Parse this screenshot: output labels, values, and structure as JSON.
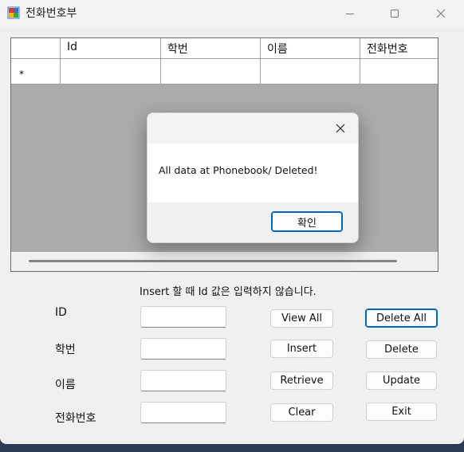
{
  "window": {
    "title": "전화번호부"
  },
  "grid": {
    "columns": [
      "Id",
      "학번",
      "이름",
      "전화번호"
    ],
    "new_row_marker": "*"
  },
  "dialog": {
    "message": "All data at Phonebook/ Deleted!",
    "ok_label": "확인"
  },
  "form": {
    "hint": "Insert 할 때 Id 값은 입력하지 않습니다.",
    "labels": {
      "id": "ID",
      "student_no": "학번",
      "name": "이름",
      "phone": "전화번호"
    },
    "fields": {
      "id": "",
      "student_no": "",
      "name": "",
      "phone": ""
    }
  },
  "buttons": {
    "view_all": "View All",
    "insert": "Insert",
    "retrieve": "Retrieve",
    "clear": "Clear",
    "delete_all": "Delete All",
    "delete": "Delete",
    "update": "Update",
    "exit": "Exit"
  },
  "colors": {
    "accent": "#0067c0",
    "grid_background": "#ababab",
    "window_background": "#f0f0f0"
  }
}
